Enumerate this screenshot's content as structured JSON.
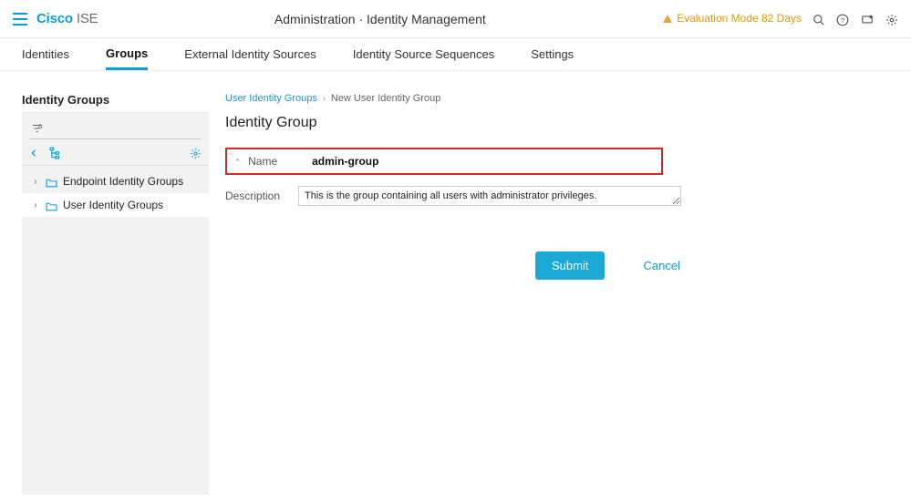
{
  "header": {
    "brand_cisco": "Cisco",
    "brand_ise": "ISE",
    "page_path": "Administration · Identity Management",
    "eval_text": "Evaluation Mode 82 Days"
  },
  "tabs": [
    {
      "label": "Identities",
      "active": false
    },
    {
      "label": "Groups",
      "active": true
    },
    {
      "label": "External Identity Sources",
      "active": false
    },
    {
      "label": "Identity Source Sequences",
      "active": false
    },
    {
      "label": "Settings",
      "active": false
    }
  ],
  "sidebar": {
    "title": "Identity Groups",
    "search_placeholder": "",
    "tree": [
      {
        "label": "Endpoint Identity Groups",
        "selected": false
      },
      {
        "label": "User Identity Groups",
        "selected": true
      }
    ]
  },
  "breadcrumb": {
    "parent": "User Identity Groups",
    "current": "New User Identity Group"
  },
  "section_title": "Identity Group",
  "form": {
    "name_label": "Name",
    "name_value": "admin-group",
    "desc_label": "Description",
    "desc_value": "This is the group containing all users with administrator privileges."
  },
  "buttons": {
    "submit": "Submit",
    "cancel": "Cancel"
  }
}
